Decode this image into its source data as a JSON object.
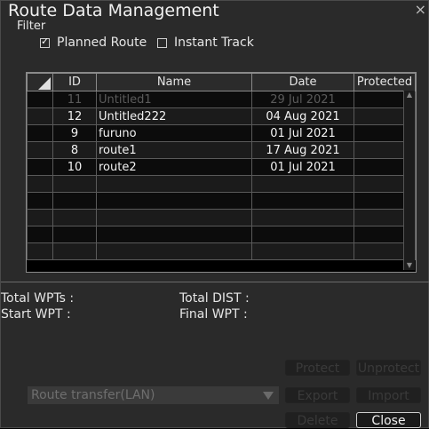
{
  "window": {
    "title": "Route Data Management",
    "close_glyph": "×"
  },
  "filter": {
    "label": "Filter",
    "options": [
      {
        "label": "Planned Route",
        "checked": true
      },
      {
        "label": "Instant Track",
        "checked": false
      }
    ]
  },
  "table": {
    "headers": {
      "id": "ID",
      "name": "Name",
      "date": "Date",
      "protected": "Protected"
    },
    "rows": [
      {
        "id": "11",
        "name": "Untitled1",
        "date": "29 Jul 2021",
        "protected": ""
      },
      {
        "id": "12",
        "name": "Untitled222",
        "date": "04 Aug 2021",
        "protected": ""
      },
      {
        "id": "9",
        "name": "furuno",
        "date": "01 Jul 2021",
        "protected": ""
      },
      {
        "id": "8",
        "name": "route1",
        "date": "17 Aug 2021",
        "protected": ""
      },
      {
        "id": "10",
        "name": "route2",
        "date": "01 Jul 2021",
        "protected": ""
      },
      {
        "id": "",
        "name": "",
        "date": "",
        "protected": ""
      },
      {
        "id": "",
        "name": "",
        "date": "",
        "protected": ""
      },
      {
        "id": "",
        "name": "",
        "date": "",
        "protected": ""
      },
      {
        "id": "",
        "name": "",
        "date": "",
        "protected": ""
      },
      {
        "id": "",
        "name": "",
        "date": "",
        "protected": ""
      }
    ]
  },
  "summary": {
    "total_wpts_label": "Total WPTs :",
    "total_dist_label": "Total DIST :",
    "start_wpt_label": "Start WPT :",
    "final_wpt_label": "Final WPT :"
  },
  "transfer": {
    "selected": "Route transfer(LAN)"
  },
  "buttons": {
    "protect": "Protect",
    "unprotect": "Unprotect",
    "export": "Export",
    "import": "Import",
    "delete": "Delete",
    "close": "Close"
  }
}
